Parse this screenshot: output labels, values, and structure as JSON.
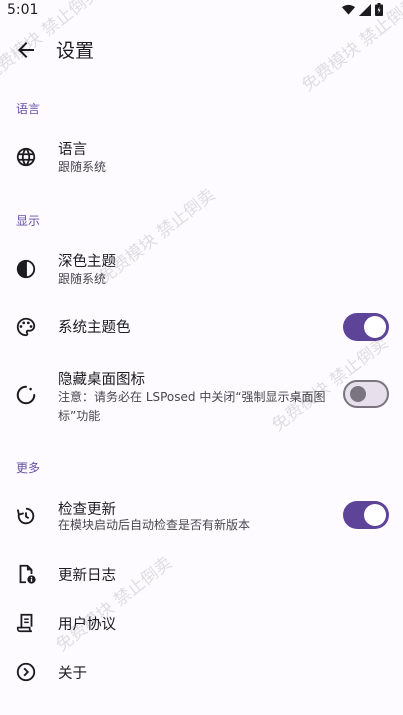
{
  "status": {
    "time": "5:01"
  },
  "header": {
    "title": "设置"
  },
  "sections": {
    "language": "语言",
    "display": "显示",
    "more": "更多"
  },
  "items": {
    "language": {
      "title": "语言",
      "subtitle": "跟随系统"
    },
    "dark_theme": {
      "title": "深色主题",
      "subtitle": "跟随系统"
    },
    "system_color": {
      "title": "系统主题色",
      "switch_on": true
    },
    "hide_icon": {
      "title": "隐藏桌面图标",
      "subtitle": "注意：请务必在 LSPosed 中关闭“强制显示桌面图标”功能",
      "switch_on": false
    },
    "check_update": {
      "title": "检查更新",
      "subtitle": "在模块启动后自动检查是否有新版本",
      "switch_on": true
    },
    "changelog": {
      "title": "更新日志"
    },
    "agreement": {
      "title": "用户协议"
    },
    "about": {
      "title": "关于"
    }
  },
  "watermark": "免费模块 禁止倒卖",
  "colors": {
    "accent": "#6750a4",
    "switch_on": "#5d4499",
    "background": "#fdfbff"
  }
}
